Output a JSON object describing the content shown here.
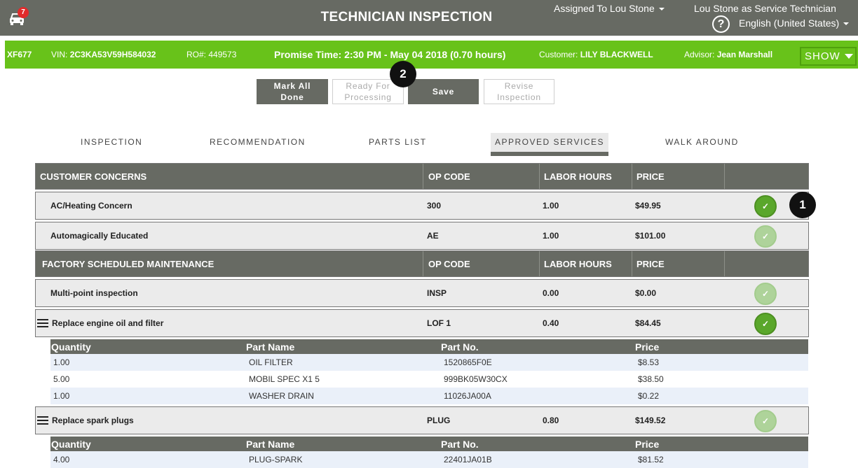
{
  "header": {
    "app_title": "TECHNICIAN INSPECTION",
    "notification_count": "7",
    "assigned_to": "Assigned To Lou Stone",
    "tech_role": "Lou Stone as Service Technician",
    "help_symbol": "?",
    "language": "English (United States)"
  },
  "ro_bar": {
    "tag": "XF677",
    "vin_label": "VIN:",
    "vin": "2C3KA53V59H584032",
    "ro_label": "RO#:",
    "ro": "449573",
    "promise": "Promise Time: 2:30 PM - May 04 2018 (0.70 hours)",
    "customer_label": "Customer:",
    "customer": "LILY BLACKWELL",
    "advisor_label": "Advisor:",
    "advisor": "Jean Marshall",
    "show_label": "SHOW"
  },
  "actions": {
    "mark_all_done_1": "Mark All",
    "mark_all_done_2": "Done",
    "ready_1": "Ready For",
    "ready_2": "Processing",
    "save": "Save",
    "revise_1": "Revise",
    "revise_2": "Inspection"
  },
  "callouts": {
    "one": "1",
    "two": "2"
  },
  "tabs": [
    {
      "label": "INSPECTION"
    },
    {
      "label": "RECOMMENDATION"
    },
    {
      "label": "PARTS LIST"
    },
    {
      "label": "APPROVED SERVICES"
    },
    {
      "label": "WALK AROUND"
    }
  ],
  "table": {
    "col_op": "OP CODE",
    "col_labor": "LABOR HOURS",
    "col_price": "PRICE",
    "section1": "CUSTOMER CONCERNS",
    "section2": "FACTORY SCHEDULED MAINTENANCE",
    "rows": [
      {
        "name": "AC/Heating Concern",
        "op": "300",
        "labor": "1.00",
        "price": "$49.95",
        "done": true
      },
      {
        "name": "Automagically Educated",
        "op": "AE",
        "labor": "1.00",
        "price": "$101.00",
        "done": false
      },
      {
        "name": "Multi-point inspection",
        "op": "INSP",
        "labor": "0.00",
        "price": "$0.00",
        "done": false
      },
      {
        "name": "Replace engine oil and filter",
        "op": "LOF 1",
        "labor": "0.40",
        "price": "$84.45",
        "done": true
      },
      {
        "name": "Replace spark plugs",
        "op": "PLUG",
        "labor": "0.80",
        "price": "$149.52",
        "done": false
      }
    ],
    "check_symbol": "✓"
  },
  "parts": {
    "col_qty": "Quantity",
    "col_name": "Part Name",
    "col_no": "Part No.",
    "col_price": "Price",
    "oil_parts": [
      {
        "qty": "1.00",
        "name": "OIL FILTER",
        "no": "1520865F0E",
        "price": "$8.53"
      },
      {
        "qty": "5.00",
        "name": "MOBIL SPEC X1 5",
        "no": "999BK05W30CX",
        "price": "$38.50"
      },
      {
        "qty": "1.00",
        "name": "WASHER DRAIN",
        "no": "11026JA00A",
        "price": "$0.22"
      }
    ],
    "plug_parts": [
      {
        "qty": "4.00",
        "name": "PLUG-SPARK",
        "no": "22401JA01B",
        "price": "$81.52"
      }
    ]
  }
}
